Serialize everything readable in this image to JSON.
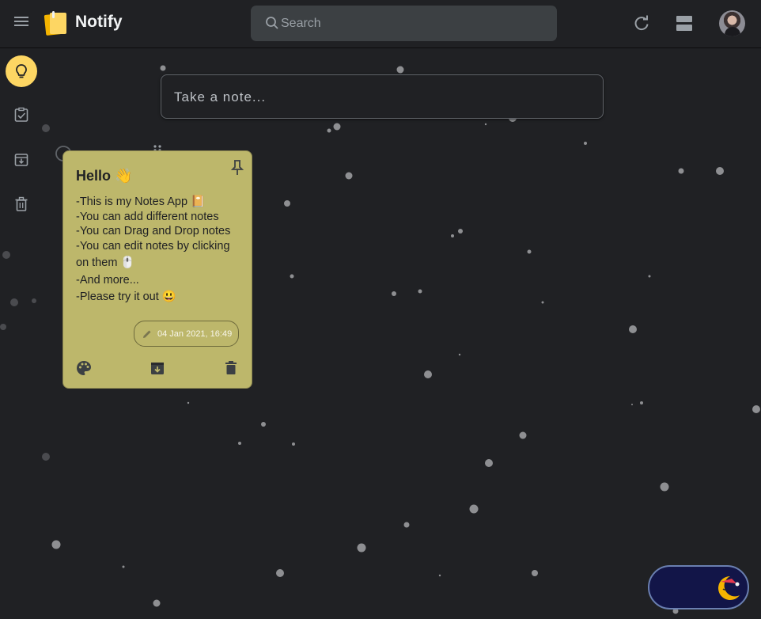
{
  "app": {
    "title": "Notify"
  },
  "search": {
    "placeholder": "Search"
  },
  "composer": {
    "placeholder": "Take a note..."
  },
  "sidebar": {
    "items": [
      {
        "icon": "lightbulb-icon",
        "active": true
      },
      {
        "icon": "checklist-icon",
        "active": false
      },
      {
        "icon": "archive-icon",
        "active": false
      },
      {
        "icon": "trash-icon",
        "active": false
      }
    ]
  },
  "note": {
    "title": "Hello 👋",
    "lines": [
      "-This is my Notes App 📔",
      "-You can add different notes",
      "-You can Drag and Drop notes",
      "-You can edit notes by clicking",
      "on them 🖱️",
      "-And more...",
      "-Please try it out 😃"
    ],
    "edited": "04 Jan 2021, 16:49",
    "color": "#bdb76b"
  },
  "colors": {
    "background": "#202124",
    "accent": "#fdd663",
    "toggle": "#121548"
  }
}
